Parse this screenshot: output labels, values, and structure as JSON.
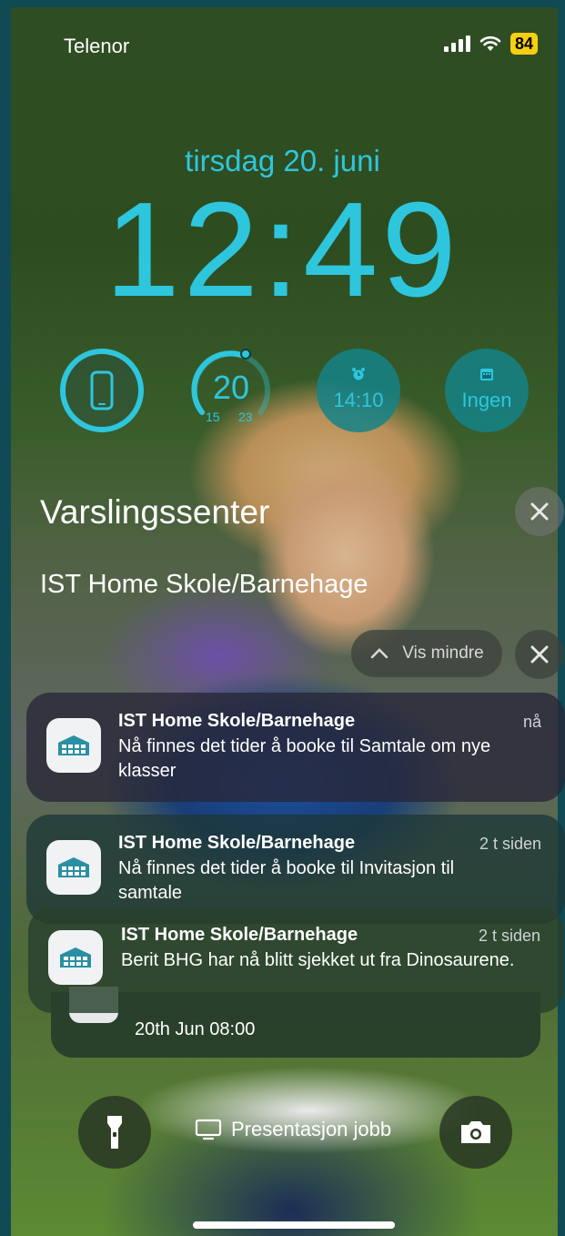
{
  "status_bar": {
    "carrier": "Telenor",
    "battery": "84"
  },
  "lock": {
    "date": "tirsdag 20. juni",
    "time": "12:49"
  },
  "widgets": {
    "temperature": {
      "current": "20",
      "low": "15",
      "high": "23"
    },
    "alarm": {
      "value": "14:10"
    },
    "calendar": {
      "value": "Ingen"
    }
  },
  "notification_center": {
    "title": "Varslingssenter",
    "group_title": "IST Home Skole/Barnehage",
    "show_less_label": "Vis mindre"
  },
  "notifications": [
    {
      "app": "IST Home Skole/Barnehage",
      "time": "nå",
      "body": "Nå finnes det tider å booke til Samtale om nye klasser"
    },
    {
      "app": "IST Home Skole/Barnehage",
      "time": "2 t siden",
      "body": "Nå finnes det tider å booke til Invitasjon til samtale"
    },
    {
      "app": "IST Home Skole/Barnehage",
      "time": "2 t siden",
      "body": "Berit BHG har nå blitt sjekket ut fra Dinosaurene."
    },
    {
      "body": "20th Jun 08:00"
    }
  ],
  "bottom": {
    "focus_label": "Presentasjon jobb"
  },
  "colors": {
    "accent": "#2ec6dd",
    "battery": "#f5d012"
  }
}
